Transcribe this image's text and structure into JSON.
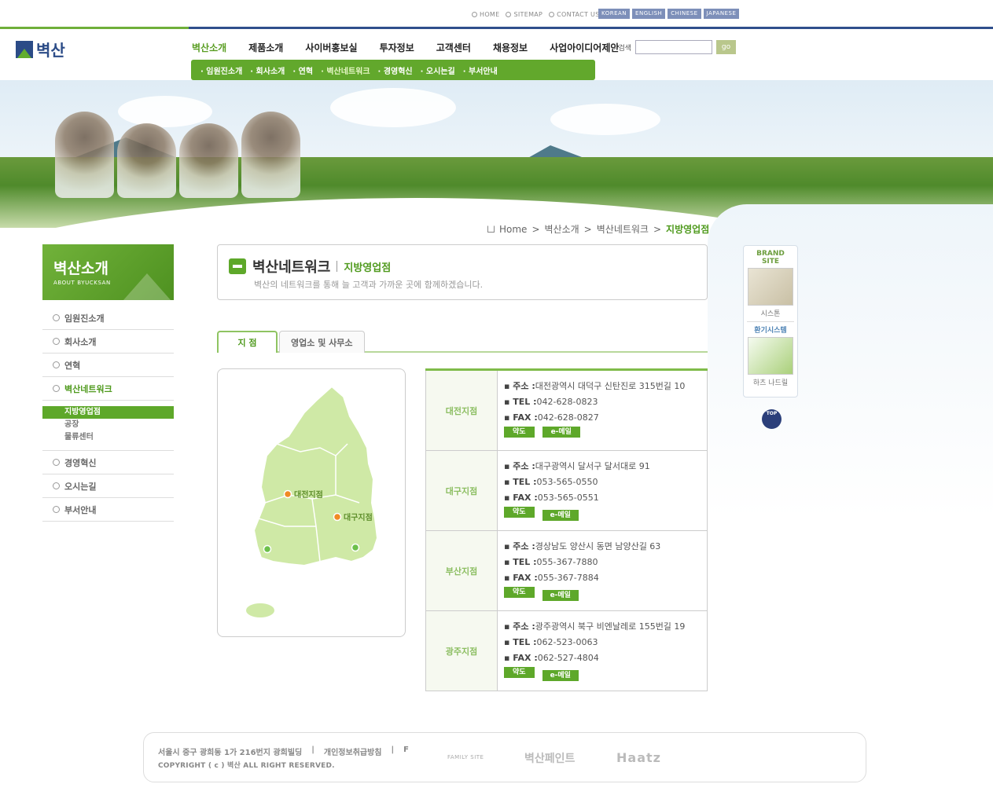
{
  "util": {
    "home": "HOME",
    "sitemap": "SITEMAP",
    "contact": "CONTACT US"
  },
  "langs": [
    "KOREAN",
    "ENGLISH",
    "CHINESE",
    "JAPANESE"
  ],
  "logo": {
    "text": "벽산"
  },
  "gnb": [
    "벽산소개",
    "제품소개",
    "사이버홍보실",
    "투자정보",
    "고객센터",
    "채용정보",
    "사업아이디어제안"
  ],
  "subnav": [
    "· 임원진소개",
    "· 회사소개",
    "· 연혁",
    "· 벽산네트워크",
    "· 경영혁신",
    "· 오시는길",
    "· 부서안내"
  ],
  "search": {
    "label": "› 검색",
    "placeholder": "",
    "go": "go"
  },
  "breadcrumb": {
    "home": "Home",
    "l1": "벽산소개",
    "l2": "벽산네트워크",
    "current": "지방영업점"
  },
  "left": {
    "title": "벽산소개",
    "subtitle": "ABOUT BYUCKSAN",
    "items": [
      "임원진소개",
      "회사소개",
      "연혁",
      "벽산네트워크"
    ],
    "subs": [
      "지방영업점",
      "공장",
      "물류센터"
    ],
    "items2": [
      "경영혁신",
      "오시는길",
      "부서안내"
    ]
  },
  "page": {
    "title": "벽산네트워크",
    "subtitle": "지방영업점",
    "desc": "벽산의 네트워크를 통해 늘 고객과 가까운 곳에 함께하겠습니다."
  },
  "tabs": [
    "지 점",
    "영업소 및 사무소"
  ],
  "map": {
    "l1": "대전지점",
    "l2": "대구지점"
  },
  "branches": [
    {
      "name": "대전지점",
      "addr": "대전광역시 대덕구 신탄진로 315번길 10",
      "tel": "042-628-0823",
      "fax": "042-628-0827"
    },
    {
      "name": "대구지점",
      "addr": "대구광역시 달서구 달서대로 91",
      "tel": "053-565-0550",
      "fax": "053-565-0551"
    },
    {
      "name": "부산지점",
      "addr": "경상남도 양산시 동면 남양산길 63",
      "tel": "055-367-7880",
      "fax": "055-367-7884"
    },
    {
      "name": "광주지점",
      "addr": "광주광역시 북구 비엔날레로 155번길 19",
      "tel": "062-523-0063",
      "fax": "062-527-4804"
    }
  ],
  "labels": {
    "addr": "▪ 주소 :",
    "tel": "▪ TEL :",
    "fax": "▪ FAX :",
    "map": "약도",
    "email": "e-메일"
  },
  "quick": {
    "brand": "BRAND SITE",
    "cap1": "시스톤",
    "brand2": "환기시스템",
    "cap2": "하츠 나드릴",
    "top": "TOP"
  },
  "footer": {
    "addr": "서울시 중구 광희동 1가 216번지 광희빌딩",
    "privacy": "개인정보취급방침",
    "f": "F",
    "copy": "COPYRIGHT ( c ) 벽산 ALL RIGHT RESERVED.",
    "family": "FAMILY SITE",
    "b1": "벽산페인트",
    "b2": "Haatz"
  },
  "colors": {
    "green": "#5ea82a",
    "navy": "#2b4b87",
    "langBtn": "#7d8fb9"
  }
}
